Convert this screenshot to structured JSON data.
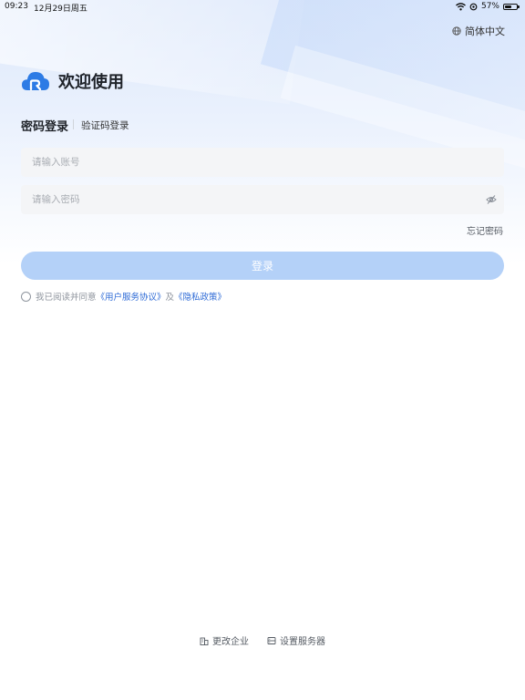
{
  "status_bar": {
    "time": "09:23",
    "date": "12月29日周五",
    "battery_text": "57%",
    "battery_level": 0.57
  },
  "language": {
    "label": "简体中文"
  },
  "header": {
    "welcome": "欢迎使用"
  },
  "tabs": [
    {
      "label": "密码登录",
      "active": true
    },
    {
      "label": "验证码登录",
      "active": false
    }
  ],
  "form": {
    "account_placeholder": "请输入账号",
    "account_value": "",
    "password_placeholder": "请输入密码",
    "password_value": "",
    "forgot_label": "忘记密码",
    "login_label": "登录"
  },
  "agreement": {
    "prefix": "我已阅读并同意",
    "terms": "《用户服务协议》",
    "and": "及",
    "privacy": "《隐私政策》"
  },
  "footer": {
    "change_company": "更改企业",
    "set_server": "设置服务器"
  },
  "colors": {
    "accent": "#2d6ad6",
    "login_button_disabled": "#b4d1f8",
    "logo_blue": "#2d7be5"
  }
}
